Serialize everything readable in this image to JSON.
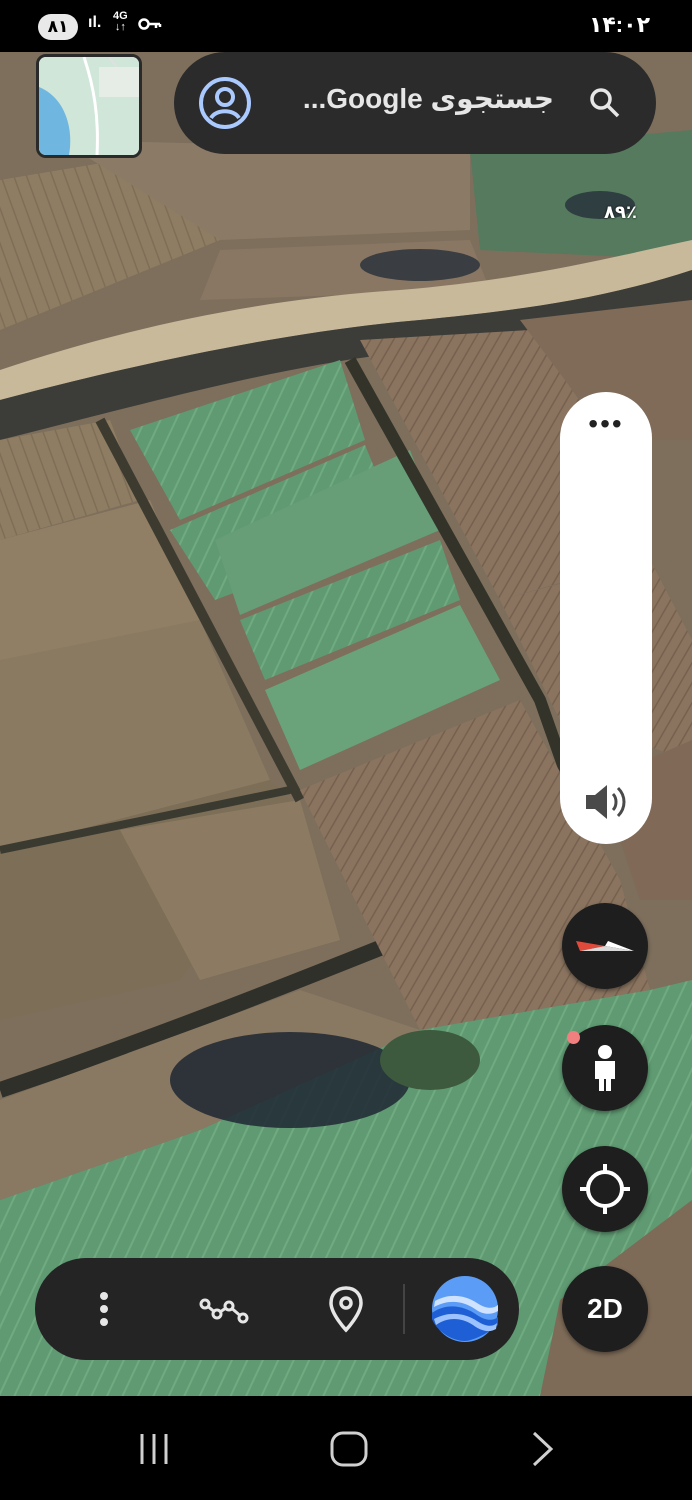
{
  "status_bar": {
    "battery": "۸۱",
    "signal": "ıl.",
    "network": "4G",
    "network_arrows": "↓↑",
    "time": "۱۴:۰۲"
  },
  "search": {
    "placeholder": "جستجوی Google..."
  },
  "map": {
    "imagery": "satellite",
    "zoom_percent": "۸۹٪"
  },
  "side_panel": {
    "more_label": "•••",
    "volume_icon": "volume-icon"
  },
  "controls": {
    "compass_icon": "compass-icon",
    "pegman_icon": "street-view-pegman-icon",
    "locate_icon": "my-location-icon",
    "view_mode": "2D"
  },
  "toolbar": {
    "items": [
      "more-vert-icon",
      "measure-path-icon",
      "place-pin-icon",
      "google-earth-logo"
    ]
  },
  "nav_bar": {
    "items": [
      "recent-apps-icon",
      "home-icon",
      "back-icon"
    ]
  },
  "colors": {
    "bar_dark": "#2b2b2b",
    "accent_blue": "#a9c9ff",
    "compass_red": "#e04a3a"
  }
}
